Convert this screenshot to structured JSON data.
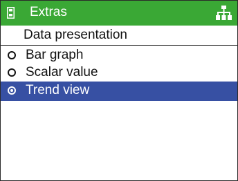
{
  "header": {
    "title": "Extras",
    "device_icon": "device-icon",
    "tree_icon": "network-tree-icon"
  },
  "subheader": {
    "label": "Data presentation"
  },
  "options": [
    {
      "label": "Bar graph",
      "selected": false
    },
    {
      "label": "Scalar value",
      "selected": false
    },
    {
      "label": "Trend view",
      "selected": true
    }
  ],
  "colors": {
    "header_bg": "#3aa835",
    "selection_bg": "#3750a3",
    "text": "#111111",
    "header_text": "#ffffff"
  }
}
